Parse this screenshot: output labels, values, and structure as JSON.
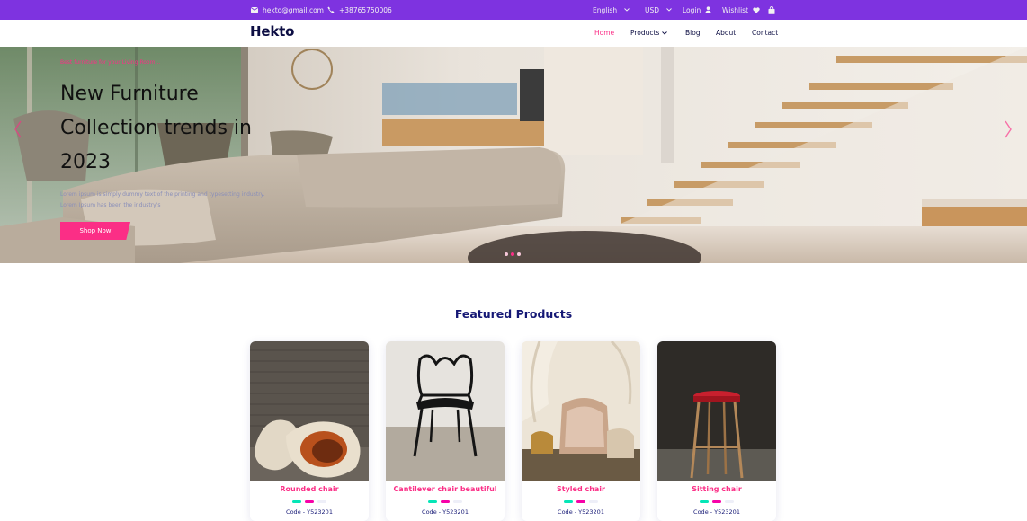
{
  "topbar": {
    "email": "hekto@gmail.com",
    "phone": "+38765750006",
    "language": "English",
    "currency": "USD",
    "login": "Login",
    "wishlist": "Wishlist"
  },
  "nav": {
    "logo": "Hekto",
    "links": [
      {
        "label": "Home",
        "active": true
      },
      {
        "label": "Products",
        "active": false
      },
      {
        "label": "Blog",
        "active": false
      },
      {
        "label": "About",
        "active": false
      },
      {
        "label": "Contact",
        "active": false
      }
    ]
  },
  "hero": {
    "subtitle": "Best furniture for your Living Room...",
    "title": "New Furniture Collection trends in 2023",
    "description": "Lorem ipsum is simply dummy text of the printing and typesetting industry. Lorem Ipsum has been the industry's",
    "button": "Shop Now",
    "slides": 3,
    "active_slide": 2
  },
  "featured": {
    "title": "Featured Products",
    "products": [
      {
        "name": "Rounded chair",
        "code": "Code - Y523201",
        "swatches": [
          "#05e6b7",
          "#f701a8",
          "#eeeff8"
        ]
      },
      {
        "name": "Cantilever chair beautiful",
        "code": "Code - Y523201",
        "swatches": [
          "#05e6b7",
          "#f701a8",
          "#eeeff8"
        ]
      },
      {
        "name": "Styled chair",
        "code": "Code - Y523201",
        "swatches": [
          "#05e6b7",
          "#f701a8",
          "#eeeff8"
        ]
      },
      {
        "name": "Sitting chair",
        "code": "Code - Y523201",
        "swatches": [
          "#05e6b7",
          "#f701a8",
          "#eeeff8"
        ]
      }
    ]
  },
  "colors": {
    "topbar": "#7e33e0",
    "accent": "#fb2e86",
    "navy": "#151875"
  },
  "icons": [
    "mail-icon",
    "phone-icon",
    "chevron-down-icon",
    "user-icon",
    "heart-icon",
    "cart-icon",
    "chevron-left-icon",
    "chevron-right-icon"
  ]
}
